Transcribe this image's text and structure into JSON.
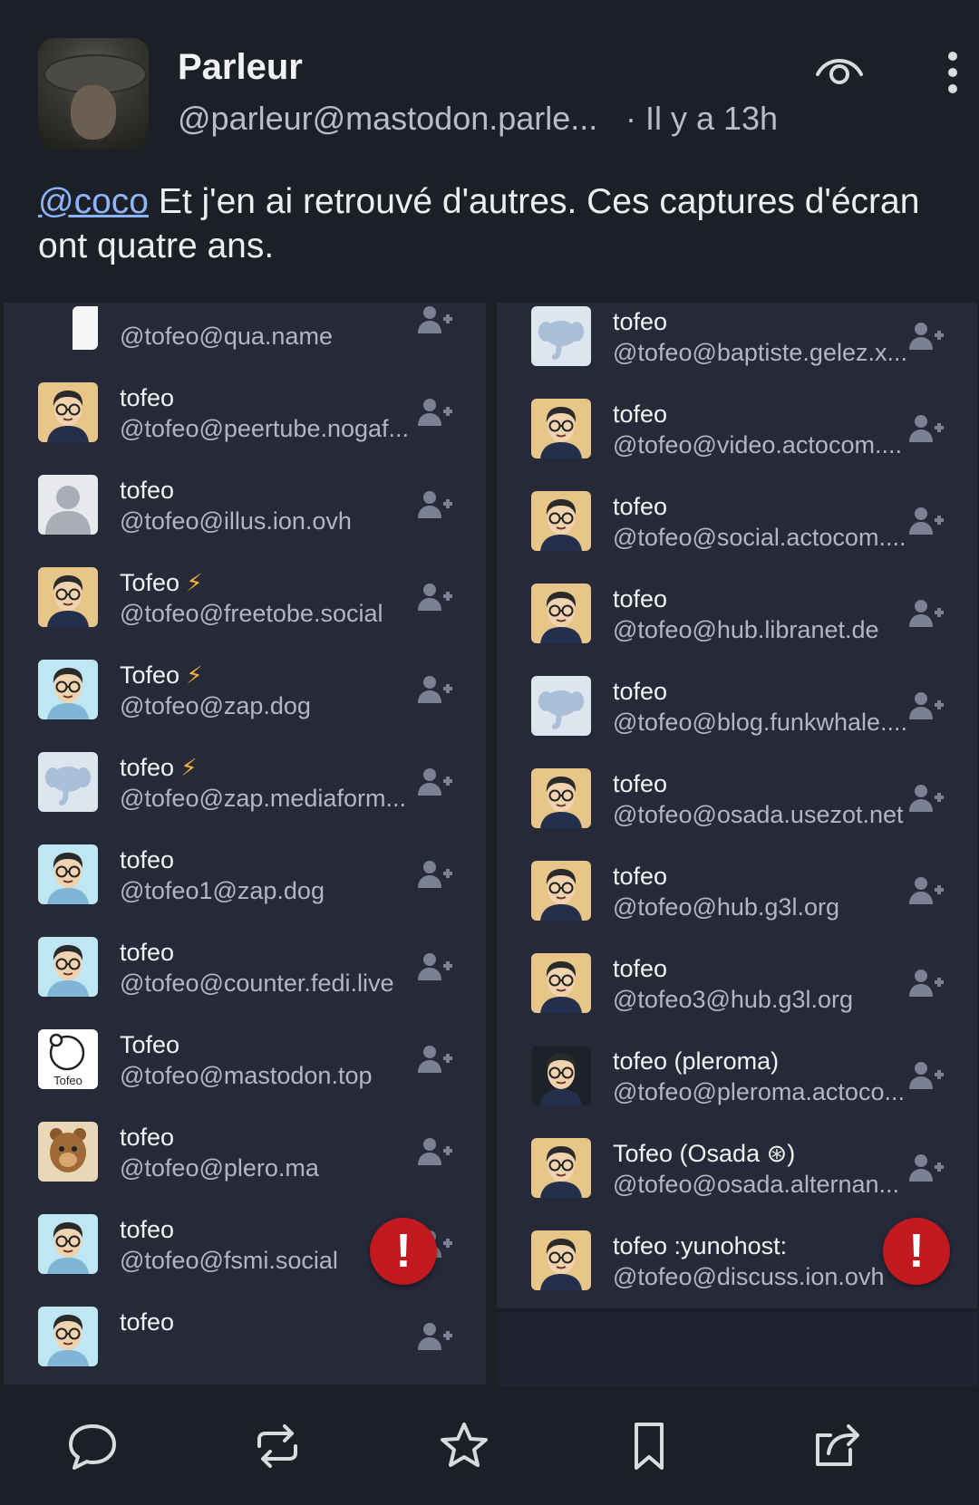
{
  "post": {
    "author_name": "Parleur",
    "author_handle": "@parleur@mastodon.parle...",
    "time": "· Il y a 13h",
    "mention": "@coco",
    "text_rest": " Et j'en ai retrouvé d'autres. Ces captures d'écran ont quatre ans."
  },
  "left_list": [
    {
      "name": "",
      "handle": "@tofeo@qua.name",
      "avatar": "t-letter-icon",
      "bolt": false
    },
    {
      "name": "tofeo",
      "handle": "@tofeo@peertube.nogaf...",
      "avatar": "face-avatar-icon",
      "bolt": false
    },
    {
      "name": "tofeo",
      "handle": "@tofeo@illus.ion.ovh",
      "avatar": "default-person-icon",
      "bolt": false
    },
    {
      "name": "Tofeo",
      "handle": "@tofeo@freetobe.social",
      "avatar": "face-avatar-icon",
      "bolt": true
    },
    {
      "name": "Tofeo",
      "handle": "@tofeo@zap.dog",
      "avatar": "face-avatar-blue-icon",
      "bolt": true
    },
    {
      "name": "tofeo",
      "handle": "@tofeo@zap.mediaform...",
      "avatar": "elephant-icon",
      "bolt": true
    },
    {
      "name": "tofeo",
      "handle": "@tofeo1@zap.dog",
      "avatar": "face-avatar-blue-icon",
      "bolt": false
    },
    {
      "name": "tofeo",
      "handle": "@tofeo@counter.fedi.live",
      "avatar": "face-avatar-blue-icon",
      "bolt": false
    },
    {
      "name": "Tofeo",
      "handle": "@tofeo@mastodon.top",
      "avatar": "tofeo-circle-logo",
      "bolt": false,
      "avatar_caption": "Tofeo"
    },
    {
      "name": "tofeo",
      "handle": "@tofeo@plero.ma",
      "avatar": "bear-icon",
      "bolt": false
    },
    {
      "name": "tofeo",
      "handle": "@tofeo@fsmi.social",
      "avatar": "face-avatar-blue-icon",
      "bolt": false
    },
    {
      "name": "tofeo",
      "handle": "",
      "avatar": "face-avatar-blue-icon",
      "bolt": false
    }
  ],
  "right_list": [
    {
      "name": "tofeo",
      "handle": "@tofeo@baptiste.gelez.x...",
      "avatar": "elephant-icon"
    },
    {
      "name": "tofeo",
      "handle": "@tofeo@video.actocom....",
      "avatar": "face-avatar-icon"
    },
    {
      "name": "tofeo",
      "handle": "@tofeo@social.actocom....",
      "avatar": "face-avatar-icon"
    },
    {
      "name": "tofeo",
      "handle": "@tofeo@hub.libranet.de",
      "avatar": "face-avatar-icon"
    },
    {
      "name": "tofeo",
      "handle": "@tofeo@blog.funkwhale....",
      "avatar": "elephant-icon"
    },
    {
      "name": "tofeo",
      "handle": "@tofeo@osada.usezot.net",
      "avatar": "face-avatar-icon"
    },
    {
      "name": "tofeo",
      "handle": "@tofeo@hub.g3l.org",
      "avatar": "face-avatar-icon"
    },
    {
      "name": "tofeo",
      "handle": "@tofeo3@hub.g3l.org",
      "avatar": "face-avatar-icon"
    },
    {
      "name": "tofeo (pleroma)",
      "handle": "@tofeo@pleroma.actoco...",
      "avatar": "face-avatar-dark-icon"
    },
    {
      "name": "Tofeo (Osada ⊛)",
      "handle": "@tofeo@osada.alternan...",
      "avatar": "face-avatar-icon"
    },
    {
      "name": "tofeo :yunohost:",
      "handle": "@tofeo@discuss.ion.ovh",
      "avatar": "face-avatar-icon"
    }
  ],
  "alert_label": "!",
  "bottom_bar": [
    "reply-icon",
    "boost-icon",
    "favourite-icon",
    "bookmark-icon",
    "share-icon"
  ],
  "colors": {
    "accent": "#8cb4ff",
    "alert": "#c2181f",
    "bolt": "#f5b534",
    "background": "#1d1f26"
  }
}
